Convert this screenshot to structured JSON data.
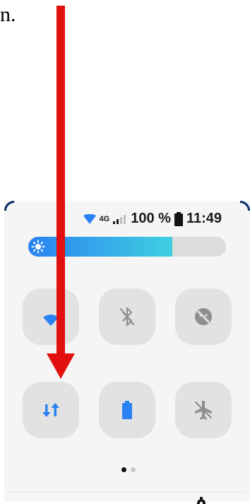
{
  "caption": {
    "text": "n."
  },
  "status_bar": {
    "network_type": "4G",
    "battery_percent": "100 %",
    "time": "11:49"
  },
  "brightness": {
    "level": 0.73
  },
  "quick_tiles": [
    {
      "id": "wifi",
      "icon": "wifi-icon",
      "active": true
    },
    {
      "id": "bluetooth",
      "icon": "bluetooth-off-icon",
      "active": false
    },
    {
      "id": "do-not-disturb",
      "icon": "do-not-disturb-icon",
      "active": false
    },
    {
      "id": "mobile-data",
      "icon": "mobile-data-icon",
      "active": true
    },
    {
      "id": "battery-saver",
      "icon": "battery-icon",
      "active": true
    },
    {
      "id": "airplane-mode",
      "icon": "airplane-icon",
      "active": false
    }
  ],
  "page_indicator": {
    "current": 1,
    "total": 2
  },
  "colors": {
    "accent": "#2a82f2",
    "tile_background": "#e2e2e2",
    "inactive_icon": "#8e8e8e",
    "annotation_arrow": "#e31010"
  }
}
